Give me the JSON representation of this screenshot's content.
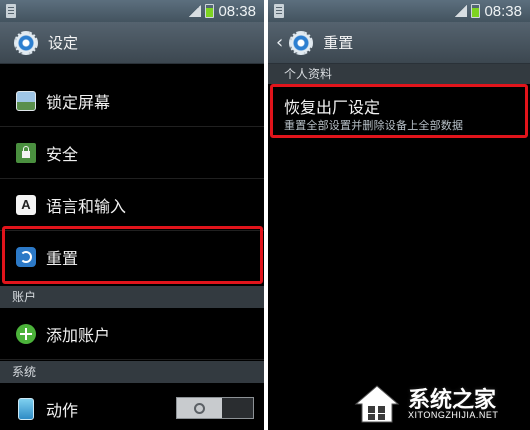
{
  "left_screen": {
    "status": {
      "time": "08:38"
    },
    "title": "设定",
    "items": [
      {
        "label": "锁定屏幕",
        "icon": "lock-screen-icon"
      },
      {
        "label": "安全",
        "icon": "security-icon"
      },
      {
        "label": "语言和输入",
        "icon": "language-icon",
        "icon_glyph": "A"
      },
      {
        "label": "重置",
        "icon": "reset-icon"
      }
    ],
    "section_accounts": "账户",
    "add_account": {
      "label": "添加账户",
      "icon": "add-icon"
    },
    "section_system": "系统",
    "motion": {
      "label": "动作",
      "icon": "motion-icon",
      "toggle_state": "off"
    }
  },
  "right_screen": {
    "status": {
      "time": "08:38"
    },
    "title": "重置",
    "section_personal": "个人资料",
    "factory_reset": {
      "title": "恢复出厂设定",
      "subtitle": "重置全部设置并删除设备上全部数据"
    }
  },
  "watermark": {
    "name": "系统之家",
    "url": "XITONGZHIJIA.NET"
  },
  "colors": {
    "highlight": "#e1141b",
    "titlebar": "#4a5762",
    "section": "#333a40",
    "accent_blue": "#2c79c7"
  }
}
